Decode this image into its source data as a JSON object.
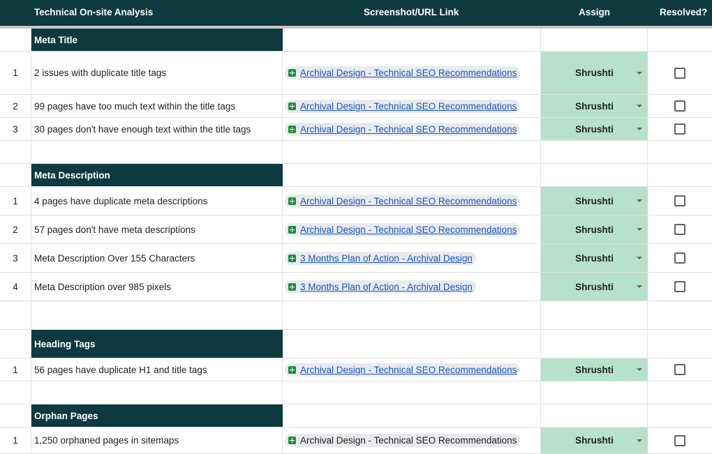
{
  "header": {
    "col_analysis": "Technical On-site Analysis",
    "col_link": "Screenshot/URL Link",
    "col_assign": "Assign",
    "col_resolved": "Resolved?"
  },
  "sections": [
    {
      "title": "Meta Title",
      "rows": [
        {
          "num": "1",
          "desc": "2 issues with duplicate title tags",
          "link": "Archival Design - Technical SEO Recommendations",
          "assign": "Shrushti",
          "resolved": false
        },
        {
          "num": "2",
          "desc": "99 pages have too much text within the title tags",
          "link": "Archival Design - Technical SEO Recommendations",
          "assign": "Shrushti",
          "resolved": false
        },
        {
          "num": "3",
          "desc": "30 pages don't have enough text within the title tags",
          "link": "Archival Design - Technical SEO Recommendations",
          "assign": "Shrushti",
          "resolved": false
        }
      ]
    },
    {
      "title": "Meta Description",
      "rows": [
        {
          "num": "1",
          "desc": "4 pages have duplicate meta descriptions",
          "link": "Archival Design - Technical SEO Recommendations",
          "assign": "Shrushti",
          "resolved": false
        },
        {
          "num": "2",
          "desc": "57 pages don't have meta descriptions",
          "link": "Archival Design - Technical SEO Recommendations",
          "assign": "Shrushti",
          "resolved": false
        },
        {
          "num": "3",
          "desc": "Meta Description Over 155 Characters",
          "link": "3 Months Plan of Action - Archival Design",
          "assign": "Shrushti",
          "resolved": false
        },
        {
          "num": "4",
          "desc": "Meta Description over 985 pixels",
          "link": "3 Months Plan of Action - Archival Design",
          "assign": "Shrushti",
          "resolved": false
        }
      ]
    },
    {
      "title": "Heading Tags",
      "rows": [
        {
          "num": "1",
          "desc": "56 pages have duplicate H1 and title tags",
          "link": "Archival Design - Technical SEO Recommendations",
          "assign": "Shrushti",
          "resolved": false
        }
      ]
    },
    {
      "title": "Orphan Pages",
      "rows": [
        {
          "num": "1",
          "desc": "1,250 orphaned pages in sitemaps",
          "link": "Archival Design - Technical SEO Recommendations",
          "link_underlined": false,
          "assign": "Shrushti",
          "resolved": false
        }
      ]
    }
  ],
  "colors": {
    "header_bg": "#0d3a3f",
    "assign_bg": "#b7e1cd",
    "link": "#1a56c4",
    "chip_icon": "#1e8e3e"
  }
}
